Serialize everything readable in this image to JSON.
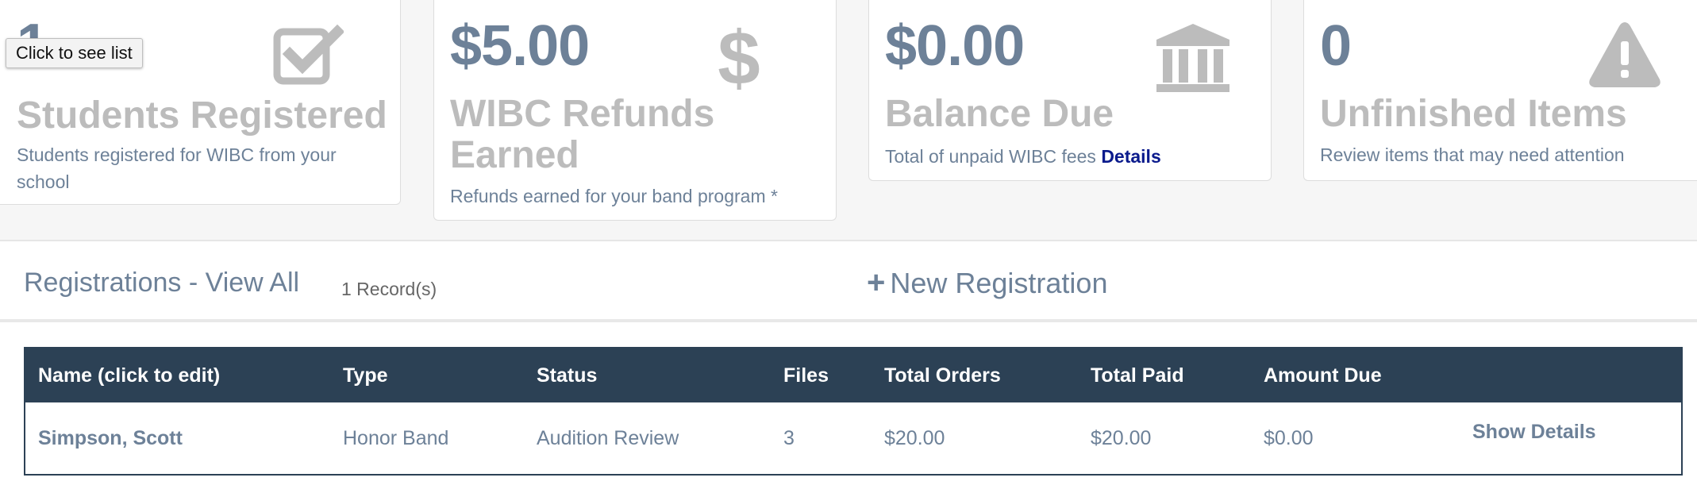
{
  "tooltip": {
    "text": "Click to see list"
  },
  "cards": {
    "students": {
      "value": "1",
      "title": "Students Registered",
      "desc": "Students registered for WIBC from your school",
      "icon": "checkbox-icon"
    },
    "refunds": {
      "value": "$5.00",
      "title": "WIBC Refunds Earned",
      "desc": "Refunds earned for your band program *",
      "icon": "dollar-icon"
    },
    "balance": {
      "value": "$0.00",
      "title": "Balance Due",
      "desc": "Total of unpaid WIBC fees",
      "link": "Details",
      "icon": "bank-icon"
    },
    "unfinished": {
      "value": "0",
      "title": "Unfinished Items",
      "desc": "Review items that may need attention",
      "icon": "warning-icon"
    }
  },
  "registrations": {
    "title": "Registrations - View All",
    "record_count": "1 Record(s)",
    "new_button_label": "New Registration",
    "columns": [
      "Name (click to edit)",
      "Type",
      "Status",
      "Files",
      "Total Orders",
      "Total Paid",
      "Amount Due",
      ""
    ],
    "rows": [
      {
        "name": "Simpson, Scott",
        "type": "Honor Band",
        "status": "Audition Review",
        "files": "3",
        "total_orders": "$20.00",
        "total_paid": "$20.00",
        "amount_due": "$0.00",
        "action": "Show Details"
      }
    ]
  },
  "colors": {
    "accent": "#6d8198",
    "header_bg": "#2c4155",
    "muted_title": "#bcbcbc",
    "link": "#0a1a8c"
  }
}
